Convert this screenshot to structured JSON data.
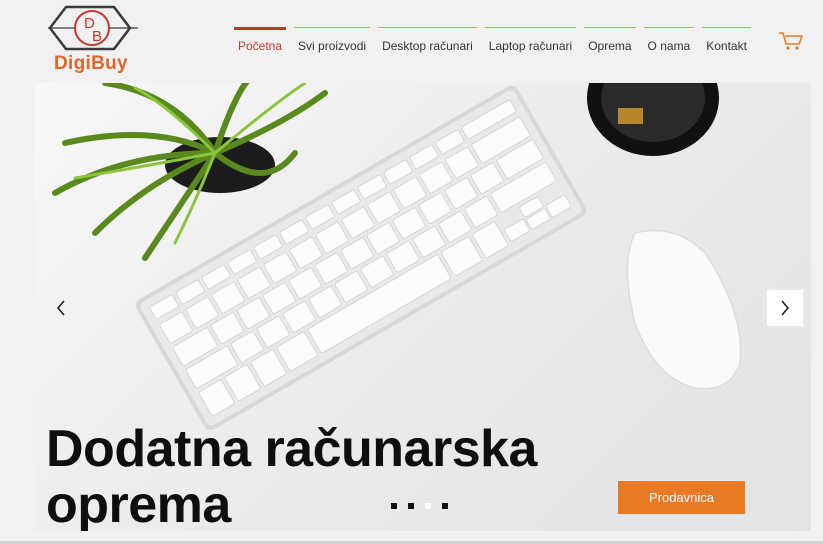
{
  "brand": {
    "monogram_top": "D",
    "monogram_bottom": "B",
    "name": "DigiBuy",
    "color": "#e2642a"
  },
  "nav": {
    "items": [
      {
        "label": "Početna",
        "active": true
      },
      {
        "label": "Svi proizvodi",
        "active": false
      },
      {
        "label": "Desktop računari",
        "active": false
      },
      {
        "label": "Laptop računari",
        "active": false
      },
      {
        "label": "Oprema",
        "active": false
      },
      {
        "label": "O nama",
        "active": false
      },
      {
        "label": "Kontakt",
        "active": false
      }
    ],
    "active_color": "#c0392b",
    "cart_icon": "shopping-cart-icon"
  },
  "hero": {
    "title": "Dodatna računarska oprema",
    "button_label": "Prodavnica",
    "button_color": "#e87a26",
    "prev_icon": "chevron-left-icon",
    "next_icon": "chevron-right-icon",
    "slide_count": 4,
    "current_slide": 3
  }
}
